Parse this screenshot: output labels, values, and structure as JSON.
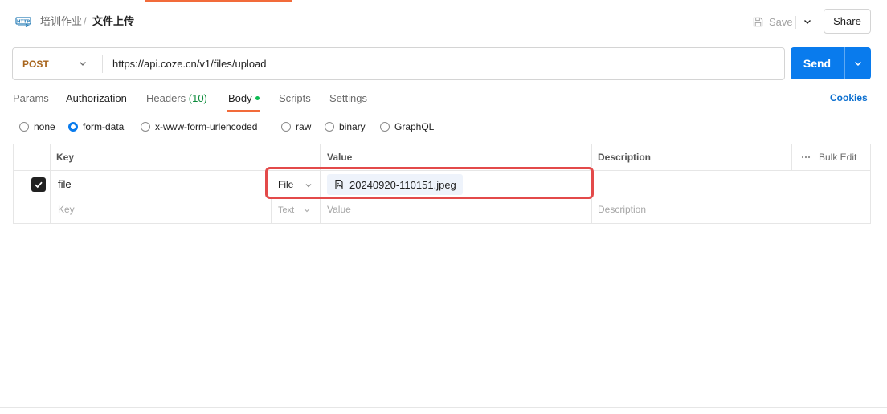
{
  "breadcrumb": {
    "parent": "培训作业",
    "separator": "/",
    "current": "文件上传"
  },
  "header": {
    "save_label": "Save",
    "share_label": "Share"
  },
  "request": {
    "method": "POST",
    "url": "https://api.coze.cn/v1/files/upload",
    "send_label": "Send"
  },
  "tabs": {
    "params": "Params",
    "authorization": "Authorization",
    "headers": "Headers",
    "headers_count": "(10)",
    "body": "Body",
    "scripts": "Scripts",
    "settings": "Settings",
    "cookies": "Cookies",
    "active": "Body"
  },
  "body_types": {
    "options": [
      "none",
      "form-data",
      "x-www-form-urlencoded",
      "raw",
      "binary",
      "GraphQL"
    ],
    "selected": "form-data"
  },
  "table": {
    "headers": {
      "key": "Key",
      "value": "Value",
      "description": "Description",
      "bulk_edit": "Bulk Edit"
    },
    "rows": [
      {
        "checked": true,
        "key": "file",
        "type": "File",
        "value": "20240920-110151.jpeg",
        "description": ""
      }
    ],
    "placeholder_row": {
      "key": "Key",
      "type": "Text",
      "value": "Value",
      "description": "Description"
    }
  },
  "colors": {
    "accent": "#f26b3a",
    "send": "#097bed",
    "method": "#a8651d",
    "highlight": "#e34a4a",
    "cookies": "#0a6ecf"
  }
}
